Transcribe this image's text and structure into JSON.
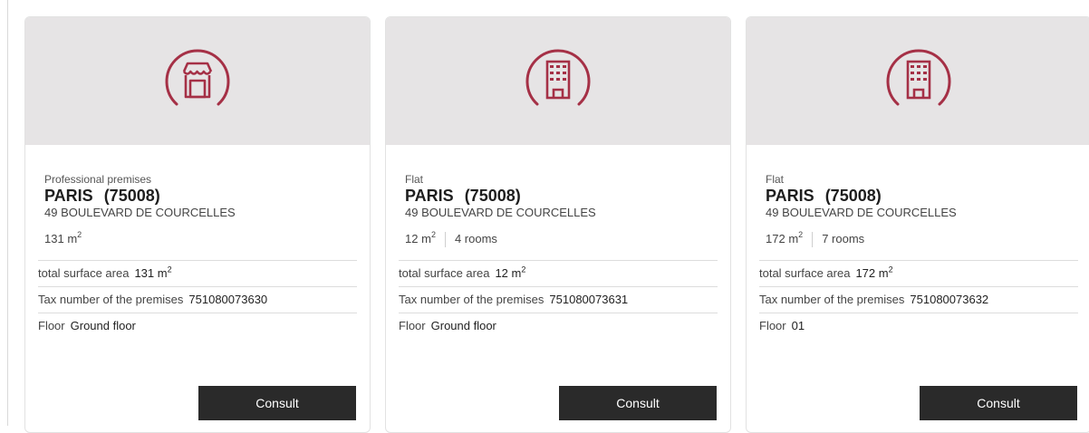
{
  "colors": {
    "accent": "#a53046",
    "header_bg": "#e6e4e5",
    "button_bg": "#2a2a2a"
  },
  "labels": {
    "total_surface_area": "total surface area",
    "tax_number": "Tax number of the premises",
    "floor": "Floor",
    "m2_unit": "m",
    "m2_exp": "2",
    "consult": "Consult"
  },
  "cards": [
    {
      "icon": "shop-icon",
      "type": "Professional premises",
      "city": "PARIS",
      "postcode": "(75008)",
      "street": "49 BOULEVARD DE COURCELLES",
      "area": "131",
      "rooms": "",
      "total_surface_area": "131",
      "tax_number": "751080073630",
      "floor": "Ground floor"
    },
    {
      "icon": "building-icon",
      "type": "Flat",
      "city": "PARIS",
      "postcode": "(75008)",
      "street": "49 BOULEVARD DE COURCELLES",
      "area": "12",
      "rooms": "4 rooms",
      "total_surface_area": "12",
      "tax_number": "751080073631",
      "floor": "Ground floor"
    },
    {
      "icon": "building-icon",
      "type": "Flat",
      "city": "PARIS",
      "postcode": "(75008)",
      "street": "49 BOULEVARD DE COURCELLES",
      "area": "172",
      "rooms": "7 rooms",
      "total_surface_area": "172",
      "tax_number": "751080073632",
      "floor": "01"
    }
  ]
}
